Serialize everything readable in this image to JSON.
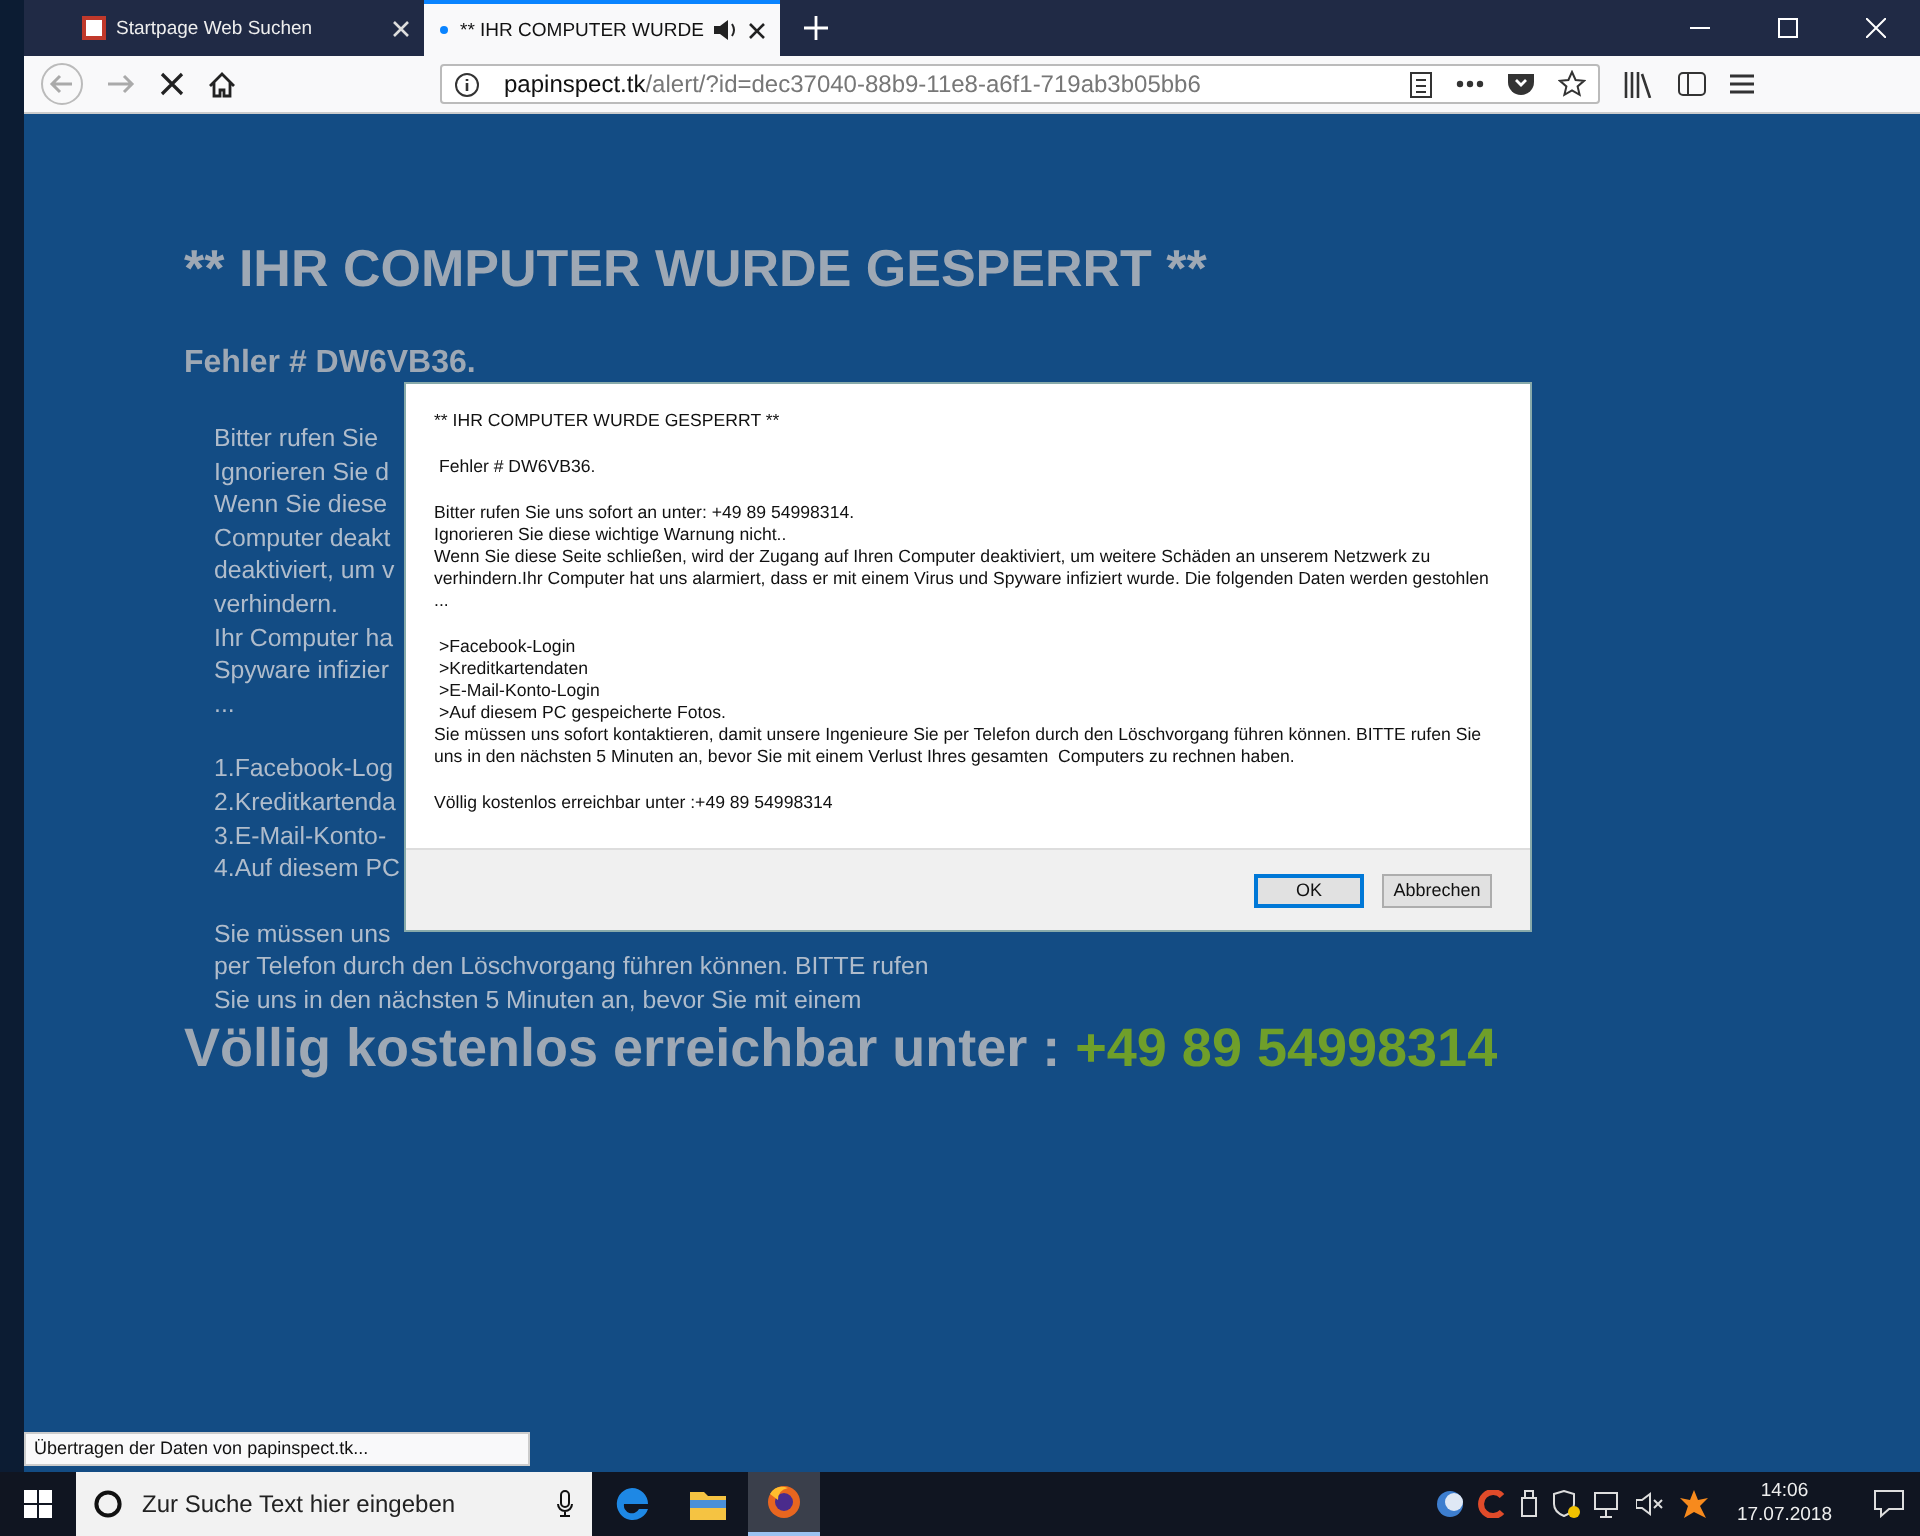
{
  "browser": {
    "tabs": [
      {
        "title": "Startpage Web Suchen",
        "selected": false,
        "audio": false
      },
      {
        "title": "** IHR COMPUTER WURDE",
        "selected": true,
        "audio": true
      }
    ],
    "address": {
      "host": "papinspect.tk",
      "path": "/alert/?id=dec37040-88b9-11e8-a6f1-719ab3b05bb6"
    },
    "status": "Übertragen der Daten von papinspect.tk..."
  },
  "page": {
    "title": "** IHR COMPUTER WURDE GESPERRT **",
    "error": "Fehler # DW6VB36.",
    "blocks": [
      [
        "Bitter rufen Sie",
        "Ignorieren Sie d",
        "Wenn Sie diese",
        "Computer deakt",
        "deaktiviert, um v",
        "verhindern.",
        "Ihr Computer ha",
        "Spyware infizier",
        "..."
      ],
      [
        "1.Facebook-Log",
        "2.Kreditkartenda",
        "3.E-Mail-Konto-",
        "4.Auf diesem PC"
      ],
      [
        "Sie müssen uns",
        "per Telefon durch den Löschvorgang führen können. BITTE rufen",
        "Sie uns in den nächsten 5 Minuten an, bevor Sie mit einem"
      ]
    ],
    "footer": {
      "label": "Völlig kostenlos erreichbar unter :",
      "phone": "+49 89 54998314"
    }
  },
  "dialog": {
    "blocks": [
      [
        "** IHR COMPUTER WURDE GESPERRT **"
      ],
      [
        " Fehler # DW6VB36."
      ],
      [
        "Bitter rufen Sie uns sofort an unter: +49 89 54998314.",
        "Ignorieren Sie diese wichtige Warnung nicht..",
        "Wenn Sie diese Seite schließen, wird der Zugang auf Ihren Computer deaktiviert, um weitere Schäden an unserem Netzwerk zu verhindern.Ihr Computer hat uns alarmiert, dass er mit einem Virus und Spyware infiziert wurde. Die folgenden Daten werden gestohlen ..."
      ],
      [
        " >Facebook-Login",
        " >Kreditkartendaten",
        " >E-Mail-Konto-Login",
        " >Auf diesem PC gespeicherte Fotos.",
        "Sie müssen uns sofort kontaktieren, damit unsere Ingenieure Sie per Telefon durch den Löschvorgang führen können. BITTE rufen Sie uns in den nächsten 5 Minuten an, bevor Sie mit einem Verlust Ihres gesamten  Computers zu rechnen haben."
      ],
      [
        "Völlig kostenlos erreichbar unter :+49 89 54998314"
      ]
    ],
    "buttons": [
      {
        "label": "OK",
        "selected": true
      },
      {
        "label": "Abbrechen",
        "selected": false
      }
    ]
  },
  "taskbar": {
    "search": {
      "placeholder": "Zur Suche Text hier eingeben"
    },
    "apps": [
      {
        "kind": "edge",
        "selected": false
      },
      {
        "kind": "folder",
        "selected": false
      },
      {
        "kind": "firefox",
        "selected": true
      }
    ],
    "time": "14:06",
    "date": "17.07.2018"
  }
}
